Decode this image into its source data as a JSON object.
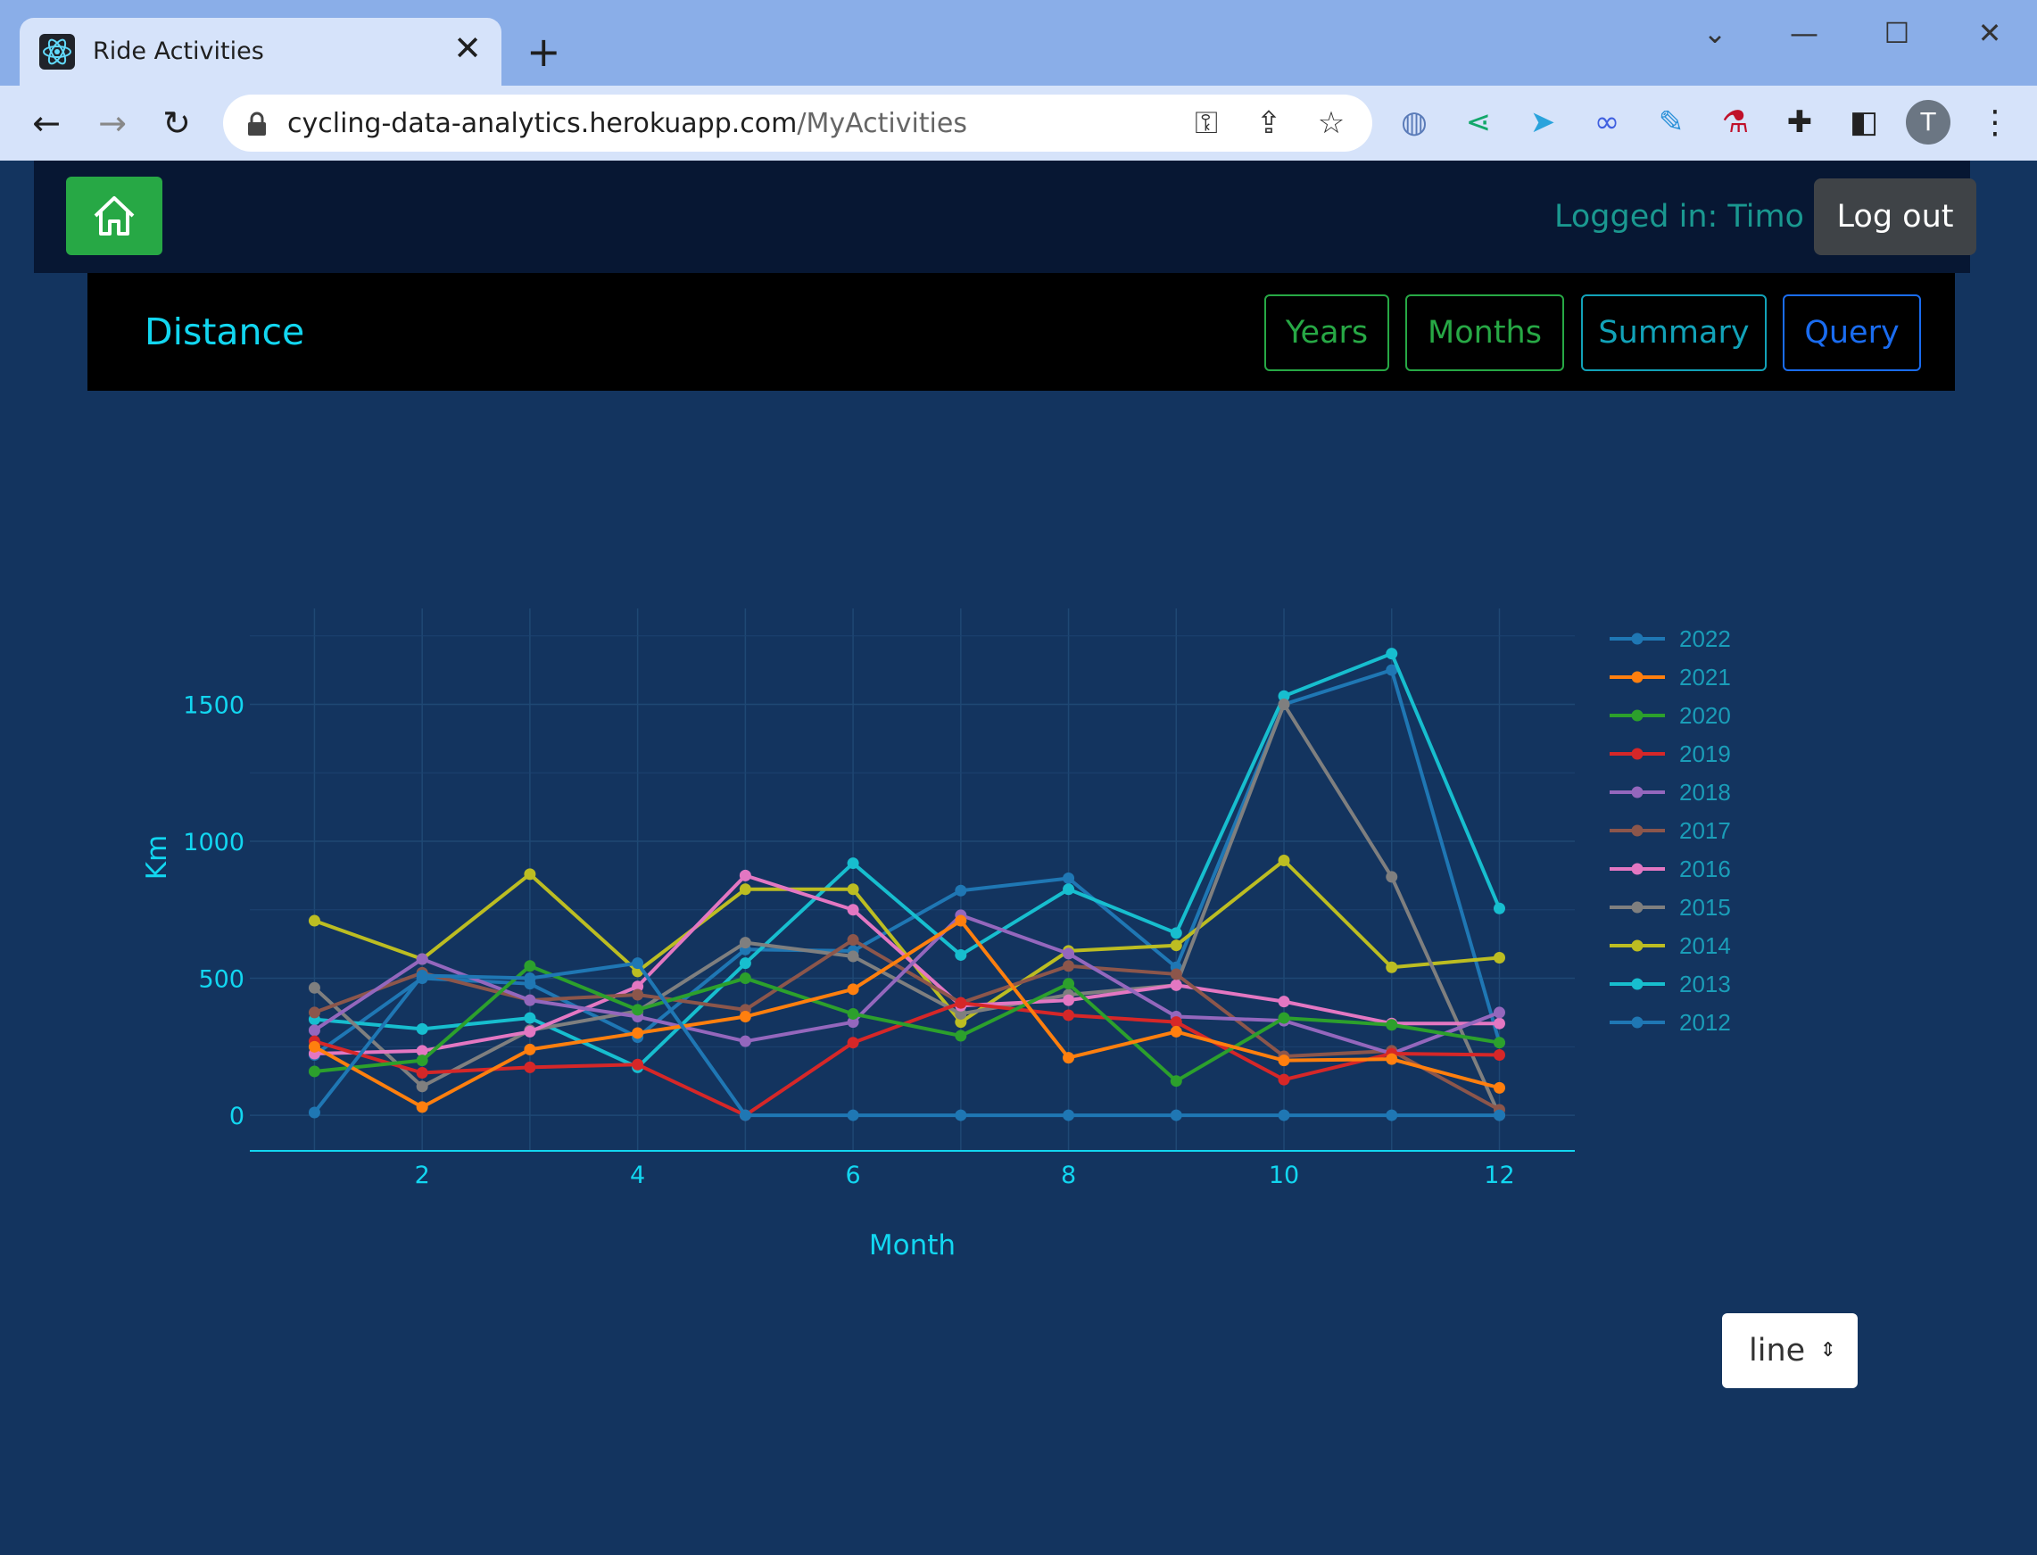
{
  "browser": {
    "tab_title": "Ride Activities",
    "tab_close": "✕",
    "new_tab": "+",
    "url_host": "cycling-data-analytics.herokuapp.com",
    "url_path": "/MyActivities",
    "avatar_letter": "T"
  },
  "header": {
    "logged_in_text": "Logged in: Timo",
    "logout_label": "Log out"
  },
  "section": {
    "title": "Distance",
    "buttons": [
      {
        "label": "Years",
        "color": "#27a845"
      },
      {
        "label": "Months",
        "color": "#27a845"
      },
      {
        "label": "Summary",
        "color": "#12a2b8"
      },
      {
        "label": "Query",
        "color": "#1a6cf0"
      }
    ]
  },
  "chart_type_select": {
    "value": "line"
  },
  "chart_data": {
    "type": "line",
    "xlabel": "Month",
    "ylabel": "Km",
    "xlim": [
      0.4,
      12.7
    ],
    "ylim": [
      -130,
      1850
    ],
    "xticks": [
      2,
      4,
      6,
      8,
      10,
      12
    ],
    "yticks": [
      0,
      500,
      1000,
      1500
    ],
    "grid": true,
    "legend_position": "right",
    "x": [
      1,
      2,
      3,
      4,
      5,
      6,
      7,
      8,
      9,
      10,
      11,
      12
    ],
    "series": [
      {
        "name": "2022",
        "color": "#1f77b4",
        "values": [
          10,
          510,
          500,
          555,
          0,
          0,
          0,
          0,
          0,
          0,
          0,
          0
        ]
      },
      {
        "name": "2021",
        "color": "#ff7f0e",
        "values": [
          250,
          30,
          240,
          300,
          360,
          460,
          710,
          210,
          305,
          200,
          205,
          100
        ]
      },
      {
        "name": "2020",
        "color": "#2ca02c",
        "values": [
          160,
          200,
          545,
          385,
          500,
          370,
          290,
          480,
          125,
          355,
          330,
          265
        ]
      },
      {
        "name": "2019",
        "color": "#d62728",
        "values": [
          270,
          155,
          175,
          185,
          0,
          265,
          410,
          365,
          340,
          130,
          225,
          220
        ]
      },
      {
        "name": "2018",
        "color": "#9467bd",
        "values": [
          310,
          570,
          420,
          360,
          270,
          340,
          730,
          590,
          360,
          345,
          225,
          375
        ]
      },
      {
        "name": "2017",
        "color": "#8c564b",
        "values": [
          375,
          520,
          420,
          440,
          385,
          640,
          410,
          545,
          515,
          215,
          235,
          20
        ]
      },
      {
        "name": "2016",
        "color": "#e377c2",
        "values": [
          225,
          235,
          305,
          470,
          875,
          750,
          400,
          420,
          475,
          415,
          335,
          335
        ]
      },
      {
        "name": "2015",
        "color": "#7f7f7f",
        "values": [
          465,
          105,
          310,
          380,
          630,
          580,
          370,
          440,
          475,
          1500,
          870,
          0
        ]
      },
      {
        "name": "2014",
        "color": "#bcbd22",
        "values": [
          710,
          570,
          880,
          525,
          825,
          825,
          340,
          600,
          620,
          930,
          540,
          575
        ]
      },
      {
        "name": "2013",
        "color": "#17becf",
        "values": [
          350,
          315,
          355,
          175,
          555,
          920,
          585,
          825,
          665,
          1530,
          1685,
          755
        ]
      },
      {
        "name": "2012",
        "color": "#1f77b4",
        "values": [
          220,
          500,
          480,
          285,
          605,
          600,
          820,
          865,
          540,
          1500,
          1625,
          265
        ]
      }
    ]
  }
}
